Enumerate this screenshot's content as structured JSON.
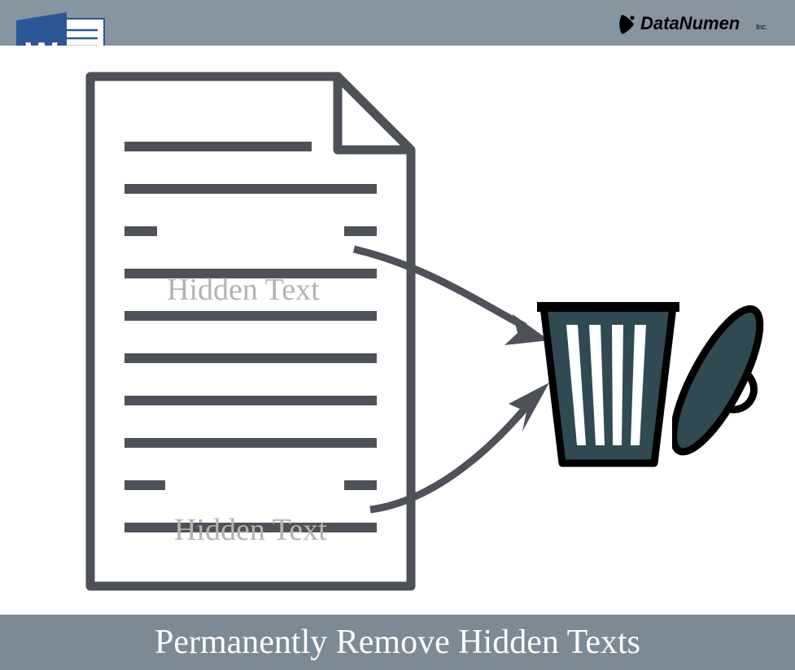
{
  "brand": {
    "name": "DataNumen",
    "suffix": "Inc."
  },
  "word_icon": {
    "letter": "W"
  },
  "document": {
    "hidden_label_1": "Hidden Text",
    "hidden_label_2": "Hidden Text"
  },
  "caption": "Permanently Remove Hidden Texts",
  "colors": {
    "top_bar": "#8695a0",
    "bottom_bar": "#7b8a95",
    "line_dark": "#4e5258",
    "hidden_gray": "#b3b3b3",
    "word_blue": "#2b5796",
    "trash_teal": "#2f4a52"
  }
}
